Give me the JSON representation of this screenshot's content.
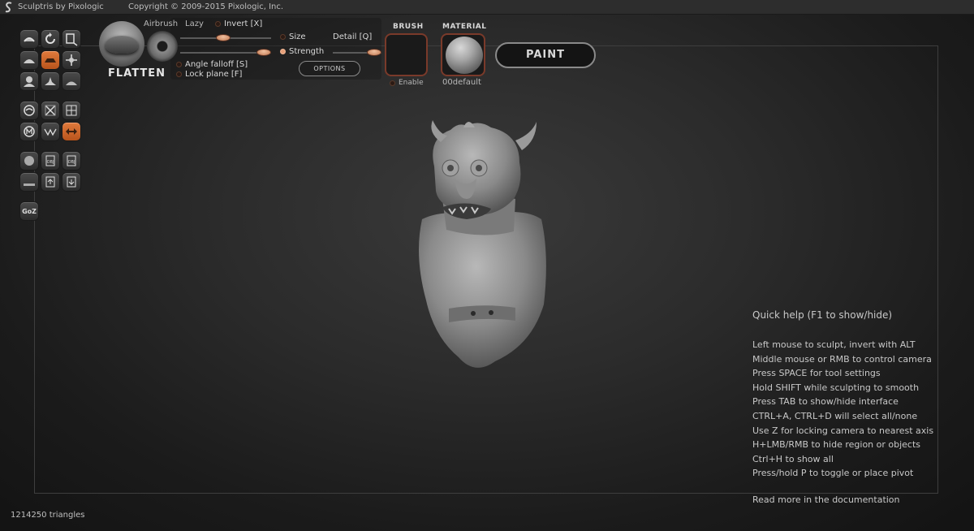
{
  "title_bar": {
    "app_name": "Sculptris by Pixologic",
    "copyright": "Copyright © 2009-2015 Pixologic, Inc."
  },
  "tool_palette": [
    {
      "icon": "crease-icon",
      "active": false
    },
    {
      "icon": "rotate-icon",
      "active": false
    },
    {
      "icon": "scale-icon",
      "active": false
    },
    {
      "icon": "flatten-icon",
      "active": true
    },
    {
      "icon": "draw-icon",
      "active": false
    },
    {
      "icon": "grab-icon",
      "active": false
    },
    {
      "icon": "inflate-icon",
      "active": false
    },
    {
      "icon": "pinch-icon",
      "active": false
    },
    {
      "icon": "smooth-icon",
      "active": false
    },
    {
      "icon": "reduce-brush-icon",
      "active": false
    },
    {
      "icon": "reduce-selected-icon",
      "active": false
    },
    {
      "icon": "subdivide-all-icon",
      "active": false
    },
    {
      "icon": "symmetry-icon",
      "active": false
    },
    {
      "icon": "wireframe-icon",
      "active": false
    },
    {
      "icon": "mirror-icon",
      "active": true
    },
    {
      "icon": "new-sphere-icon",
      "active": false
    },
    {
      "icon": "import-obj-icon",
      "active": false
    },
    {
      "icon": "export-obj-icon",
      "active": false
    },
    {
      "icon": "new-plane-icon",
      "active": false
    },
    {
      "icon": "open-file-icon",
      "active": false
    },
    {
      "icon": "save-file-icon",
      "active": false
    },
    {
      "icon": "goz-icon",
      "active": false,
      "label": "GoZ"
    }
  ],
  "brush_settings": {
    "tool_name": "FLATTEN",
    "airbrush_label": "Airbrush",
    "lazy_label": "Lazy",
    "invert_label": "Invert [X]",
    "size_label": "Size",
    "detail_label": "Detail [Q]",
    "strength_label": "Strength",
    "angle_falloff_label": "Angle falloff [S]",
    "lock_plane_label": "Lock plane [F]",
    "options_label": "OPTIONS",
    "size_value": 0.5,
    "strength_value": 0.8,
    "detail_value": 0.9
  },
  "brush_box": {
    "title": "BRUSH",
    "enable_label": "Enable"
  },
  "material_box": {
    "title": "MATERIAL",
    "material_name": "00default"
  },
  "paint_button": {
    "label": "PAINT"
  },
  "quick_help": {
    "title": "Quick help (F1 to show/hide)",
    "items": [
      "Left mouse to sculpt, invert with ALT",
      "Middle mouse or RMB to control camera",
      "Press SPACE for tool settings",
      "Hold SHIFT while sculpting to smooth",
      "Press TAB to show/hide interface",
      "CTRL+A, CTRL+D will select all/none",
      "Use Z for locking camera to nearest axis",
      "H+LMB/RMB to hide region or objects",
      "Ctrl+H to show all",
      "Press/hold P to toggle or place pivot"
    ],
    "doc_link": "Read more in the documentation"
  },
  "status": {
    "triangles": "1214250 triangles"
  },
  "colors": {
    "accent": "#d0703a",
    "background": "#2b2b2b"
  }
}
